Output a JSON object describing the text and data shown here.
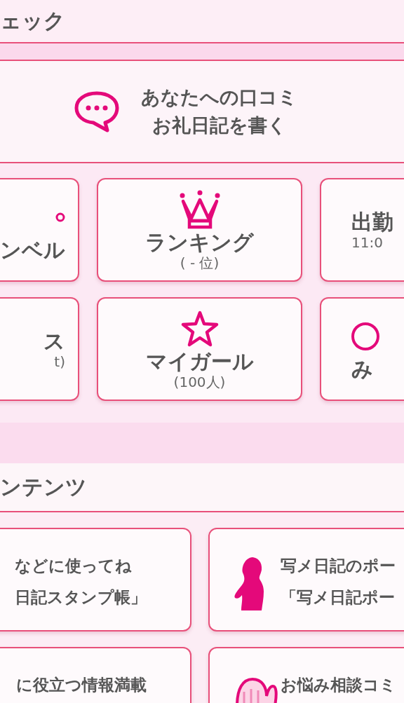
{
  "check_section": {
    "heading": "ェック",
    "banner": {
      "lines": [
        "あなたへの口コミ",
        "お礼日記を書く"
      ]
    },
    "tiles": [
      {
        "title": "ンベル"
      },
      {
        "title": "ランキング",
        "subtitle": "( - 位)"
      },
      {
        "title": "出勤",
        "subtitle": "11:0"
      },
      {
        "title": "ス",
        "subtitle": "t)"
      },
      {
        "title": "マイガール",
        "subtitle": "(100人)"
      },
      {
        "title": "み"
      }
    ]
  },
  "contents_section": {
    "heading": "ンテンツ",
    "tiles": [
      {
        "lines": [
          "などに使ってね",
          "日記スタンプ帳」"
        ]
      },
      {
        "lines": [
          "写メ日記のポー",
          "「写メ日記ポー"
        ]
      },
      {
        "lines": [
          "に役立つ情報満載"
        ]
      },
      {
        "lines": [
          "お悩み相談コミ"
        ]
      }
    ]
  }
}
